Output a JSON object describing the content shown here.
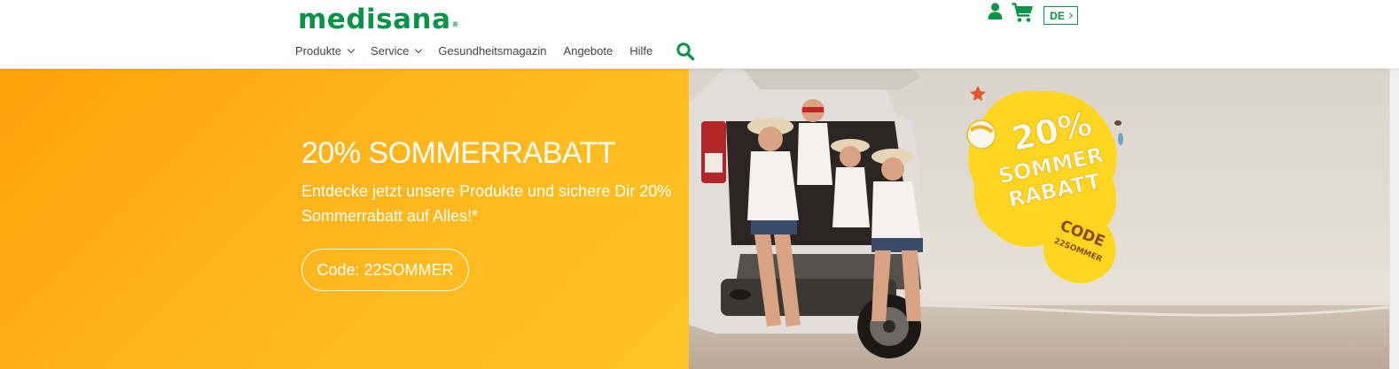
{
  "header": {
    "logo_text": "medisana",
    "logo_mark": "®",
    "nav": [
      {
        "label": "Produkte",
        "has_dropdown": true
      },
      {
        "label": "Service",
        "has_dropdown": true
      },
      {
        "label": "Gesundheitsmagazin",
        "has_dropdown": false
      },
      {
        "label": "Angebote",
        "has_dropdown": false
      },
      {
        "label": "Hilfe",
        "has_dropdown": false
      }
    ],
    "icons": [
      "search-icon",
      "user-icon",
      "cart-icon"
    ],
    "language": "DE"
  },
  "banner": {
    "title": "20% SOMMERRABATT",
    "text": "Entdecke jetzt unsere Produkte und sichere Dir 20% Sommerrabatt auf Alles!*",
    "code_button": "Code: 22SOMMER",
    "badge": {
      "line1": "20%",
      "line2": "SOMMER",
      "line3": "RABATT",
      "code_label": "CODE",
      "code_value": "22SOMMER"
    }
  },
  "colors": {
    "brand_green": "#0a9447",
    "banner_orange": "#ffa10a",
    "banner_yellow": "#ffc524",
    "badge_yellow": "#ffd61f",
    "badge_brown": "#8a4a1e"
  }
}
